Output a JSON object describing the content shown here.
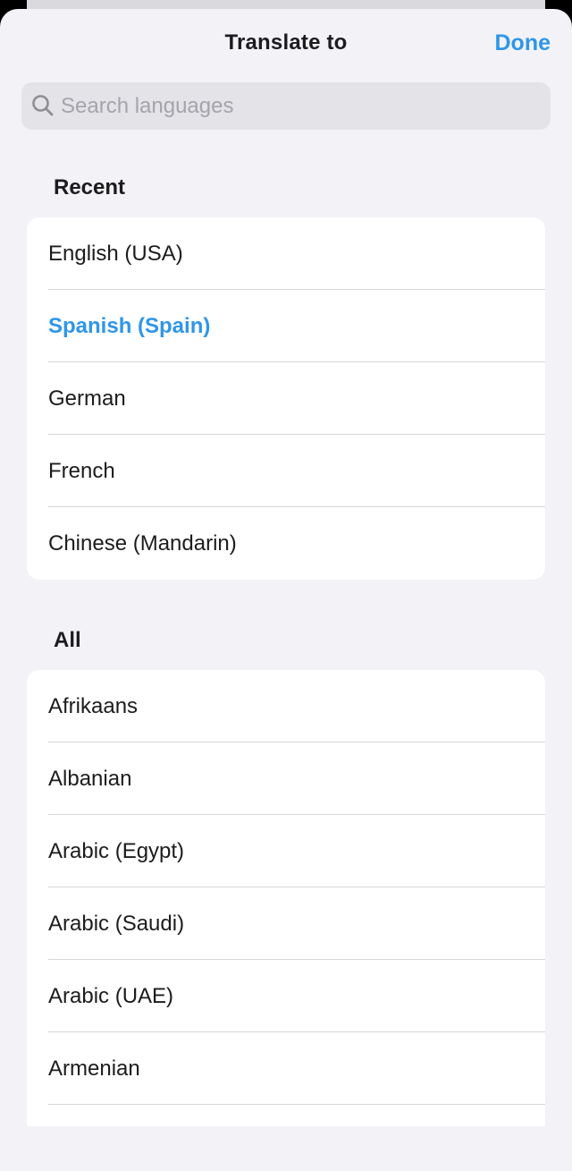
{
  "header": {
    "title": "Translate to",
    "done_label": "Done"
  },
  "search": {
    "placeholder": "Search languages",
    "value": ""
  },
  "colors": {
    "accent": "#2f96e8",
    "background": "#f2f2f7",
    "cell": "#ffffff"
  },
  "recent": {
    "title": "Recent",
    "items": [
      {
        "label": "English (USA)",
        "selected": false
      },
      {
        "label": "Spanish (Spain)",
        "selected": true
      },
      {
        "label": "German",
        "selected": false
      },
      {
        "label": "French",
        "selected": false
      },
      {
        "label": "Chinese (Mandarin)",
        "selected": false
      }
    ]
  },
  "all": {
    "title": "All",
    "items": [
      {
        "label": "Afrikaans"
      },
      {
        "label": "Albanian"
      },
      {
        "label": "Arabic (Egypt)"
      },
      {
        "label": "Arabic (Saudi)"
      },
      {
        "label": "Arabic (UAE)"
      },
      {
        "label": "Armenian"
      }
    ]
  }
}
